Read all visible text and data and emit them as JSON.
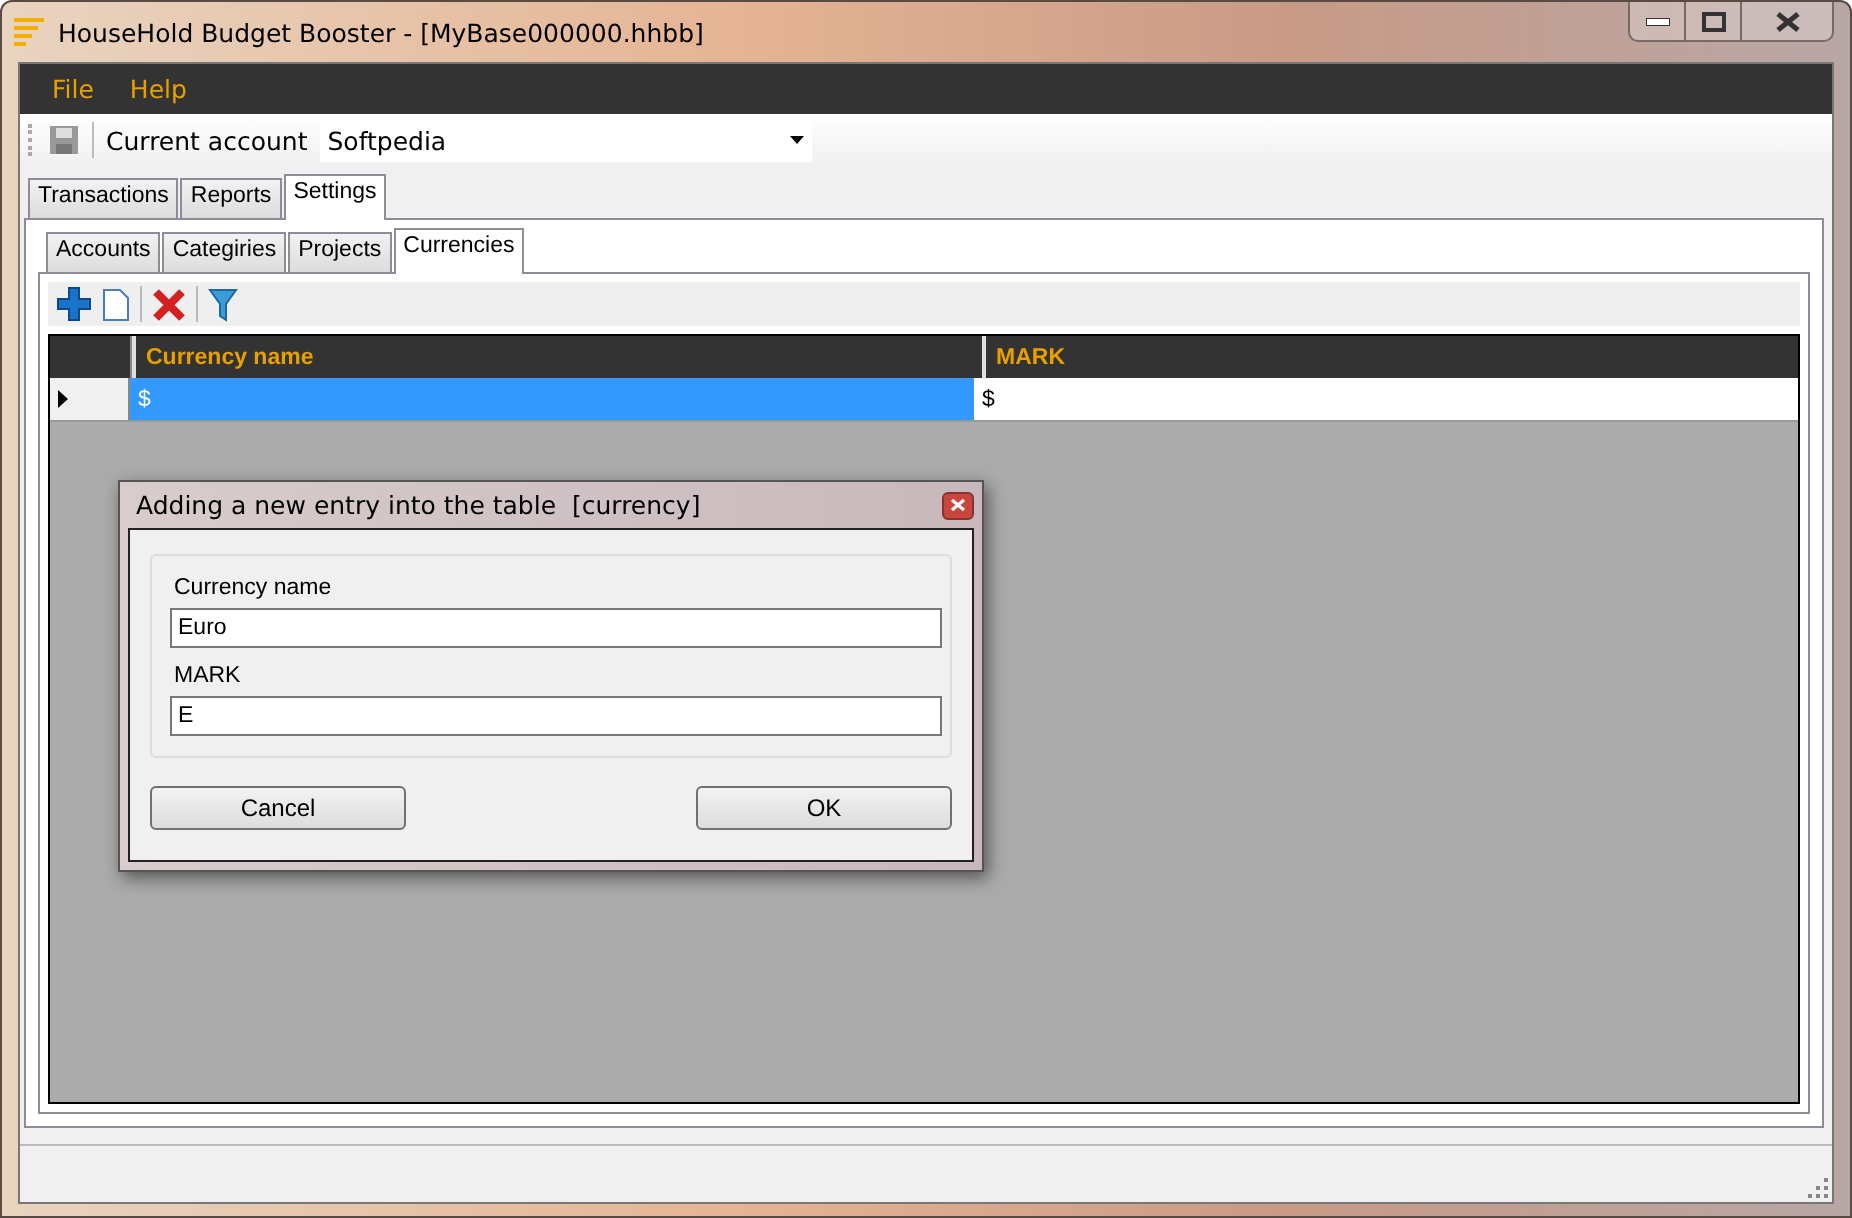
{
  "window": {
    "title": "HouseHold Budget Booster - [MyBase000000.hhbb]"
  },
  "menu": [
    "File",
    "Help"
  ],
  "toolbar": {
    "account_label": "Current account",
    "account_value": "Softpedia"
  },
  "tabs": [
    {
      "label": "Transactions",
      "selected": false
    },
    {
      "label": "Reports",
      "selected": false
    },
    {
      "label": "Settings",
      "selected": true
    }
  ],
  "subtabs": [
    {
      "label": "Accounts",
      "selected": false
    },
    {
      "label": "Categiries",
      "selected": false
    },
    {
      "label": "Projects",
      "selected": false
    },
    {
      "label": "Currencies",
      "selected": true
    }
  ],
  "grid": {
    "columns": [
      "Currency name",
      "MARK"
    ],
    "rows": [
      {
        "cells": [
          "$",
          "$"
        ],
        "selected": true
      }
    ]
  },
  "dialog": {
    "title": "Adding a new entry into the table  [currency]",
    "fields": [
      {
        "label": "Currency name",
        "value": "Euro"
      },
      {
        "label": "MARK",
        "value": "E"
      }
    ],
    "buttons": [
      "Cancel",
      "OK"
    ]
  }
}
